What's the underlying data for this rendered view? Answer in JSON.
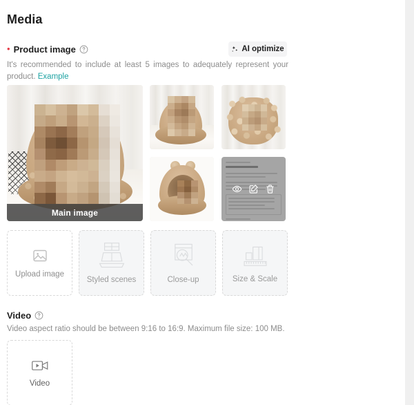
{
  "section": {
    "title": "Media"
  },
  "product_image": {
    "required_marker": "•",
    "label": "Product image",
    "help_icon": "question-circle-icon",
    "hint_text": "It's recommended to include at least 5 images to adequately represent your product.",
    "hint_link": "Example",
    "ai_button": {
      "label": "AI optimize",
      "icon": "sparkle-icon"
    },
    "main_badge": "Main image",
    "thumbnails": [
      {
        "name": "product-photo-1",
        "badge": "Main image",
        "selected": true
      },
      {
        "name": "product-photo-2",
        "badge": "",
        "selected": false
      },
      {
        "name": "product-photo-3",
        "badge": "",
        "selected": false
      },
      {
        "name": "product-photo-4",
        "badge": "",
        "selected": false
      },
      {
        "name": "product-document-5",
        "badge": "",
        "selected": false
      }
    ],
    "hover_actions": [
      {
        "name": "preview-icon",
        "label": "Preview"
      },
      {
        "name": "edit-icon",
        "label": "Edit"
      },
      {
        "name": "delete-icon",
        "label": "Delete"
      }
    ],
    "placeholders": [
      {
        "label": "Upload image",
        "icon": "image-icon",
        "filled": false
      },
      {
        "label": "Styled scenes",
        "icon": "styled-scene-icon",
        "filled": true
      },
      {
        "label": "Close-up",
        "icon": "magnifier-icon",
        "filled": true
      },
      {
        "label": "Size & Scale",
        "icon": "ruler-boxes-icon",
        "filled": true
      }
    ]
  },
  "video": {
    "label": "Video",
    "help_icon": "question-circle-icon",
    "hint_text": "Video aspect ratio should be between 9:16 to 16:9. Maximum file size: 100 MB.",
    "card_label": "Video",
    "card_icon": "video-camera-icon"
  },
  "colors": {
    "accent_link": "#1fa3a3",
    "required": "#e63946",
    "text_primary": "#1f1f1f",
    "text_muted": "#8c8c8c",
    "placeholder_bg": "#f5f6f7",
    "badge_bg": "rgba(60,60,60,0.82)"
  }
}
